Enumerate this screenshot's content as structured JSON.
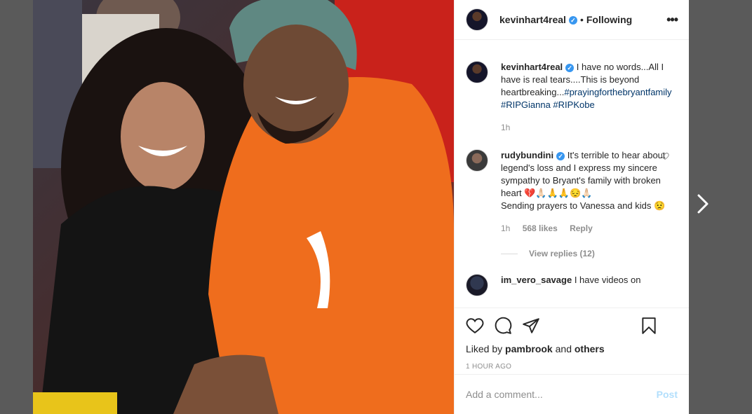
{
  "post": {
    "username": "kevinhart4real",
    "separator": "•",
    "follow_status": "Following",
    "more_glyph": "•••",
    "verified_glyph": "✓"
  },
  "caption": {
    "user": "kevinhart4real",
    "text": "I have no words...All I have is real tears....This is beyond heartbreaking...",
    "hashtags": "#prayingforthebryantfamily #RIPGianna #RIPKobe",
    "time": "1h"
  },
  "comments": [
    {
      "user": "rudybundini",
      "text": "It's terrible to hear about legend's loss and I express my sincere sympathy to Bryant's family with broken heart 💔🙏🏻🙏🙏😔🙏🏻",
      "text2": "Sending prayers to Vanessa and kids 😟",
      "time": "1h",
      "likes": "568 likes",
      "reply": "Reply",
      "view_replies": "View replies (12)"
    },
    {
      "user": "im_vero_savage",
      "text": "I have videos on"
    }
  ],
  "actions": {
    "liked_prefix": "Liked by",
    "liked_user": "pambrook",
    "liked_and": "and",
    "liked_others": "others",
    "time_ago": "1 HOUR AGO"
  },
  "add_comment": {
    "placeholder": "Add a comment...",
    "post_label": "Post"
  },
  "colors": {
    "link": "#003569",
    "verified": "#3897f0",
    "muted": "#8e8e8e",
    "post_disabled": "#b2dffc"
  }
}
